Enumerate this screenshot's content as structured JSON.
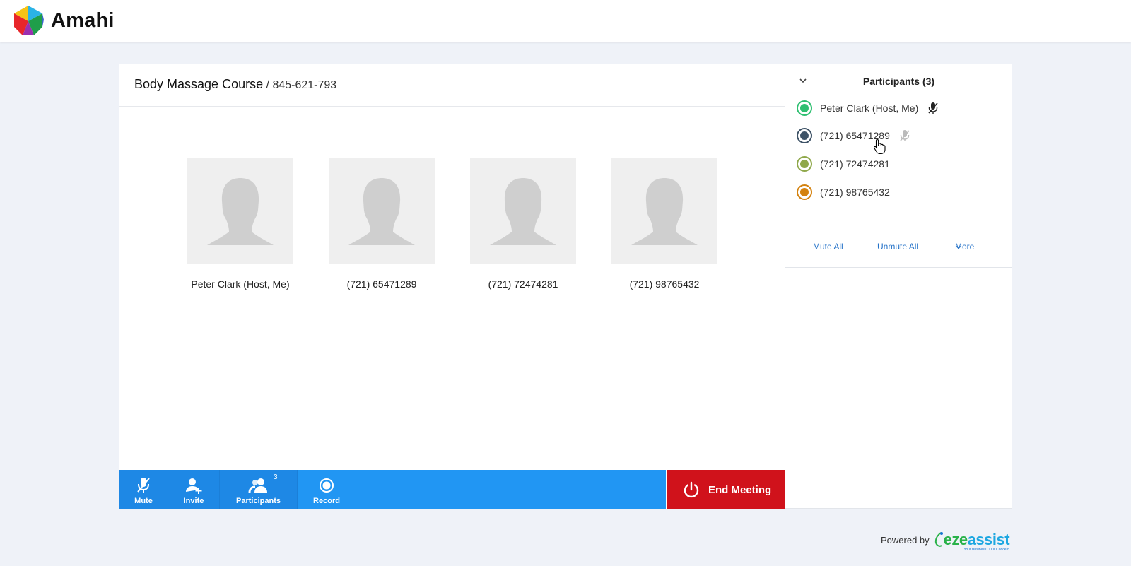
{
  "app": {
    "name": "Amahi"
  },
  "meeting": {
    "title": "Body Massage Course",
    "separator": " / ",
    "id": "845-621-793"
  },
  "tiles": [
    {
      "name": "Peter Clark (Host, Me)"
    },
    {
      "name": "(721) 65471289"
    },
    {
      "name": "(721) 72474281"
    },
    {
      "name": "(721) 98765432"
    }
  ],
  "toolbar": {
    "mute_label": "Mute",
    "invite_label": "Invite",
    "participants_label": "Participants",
    "participants_badge": "3",
    "record_label": "Record",
    "end_label": "End Meeting"
  },
  "sidebar": {
    "title": "Participants (3)",
    "participants": [
      {
        "name": "Peter Clark (Host, Me)",
        "color": "#2fbf71",
        "mic": "mic-muted-dark"
      },
      {
        "name": "(721) 65471289",
        "color": "#3d5266",
        "mic": "mic-muted-light"
      },
      {
        "name": "(721) 72474281",
        "color": "#8fa84a",
        "mic": ""
      },
      {
        "name": "(721) 98765432",
        "color": "#d4820f",
        "mic": ""
      }
    ],
    "actions": {
      "mute_all": "Mute All",
      "unmute_all": "Unmute All",
      "more": "More"
    }
  },
  "footer": {
    "powered_by": "Powered by",
    "brand_a": "eze",
    "brand_b": "assist",
    "brand_tag": "Your Business | Our Concern"
  },
  "colors": {
    "toolbar": "#2196f3",
    "end_button": "#d0121b",
    "link": "#2472c8"
  }
}
